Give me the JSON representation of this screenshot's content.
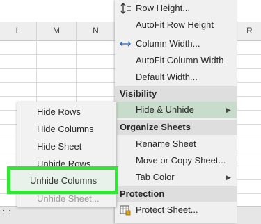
{
  "columns": {
    "left": [
      "L",
      "M",
      "N"
    ],
    "right": "R"
  },
  "format_menu": {
    "cell_size_items": [
      "Row Height...",
      "AutoFit Row Height",
      "Column Width...",
      "AutoFit Column Width",
      "Default Width..."
    ],
    "visibility_header": "Visibility",
    "hide_unhide": "Hide & Unhide",
    "organize_header": "Organize Sheets",
    "organize_items": [
      "Rename Sheet",
      "Move or Copy Sheet...",
      "Tab Color"
    ],
    "protection_header": "Protection",
    "protect_sheet": "Protect Sheet..."
  },
  "submenu": {
    "items": [
      "Hide Rows",
      "Hide Columns",
      "Hide Sheet",
      "Unhide Rows",
      "Unhide Columns",
      "Unhide Sheet..."
    ]
  },
  "colors": {
    "highlight": "#33e635",
    "menu_hover": "#c7dccb"
  }
}
